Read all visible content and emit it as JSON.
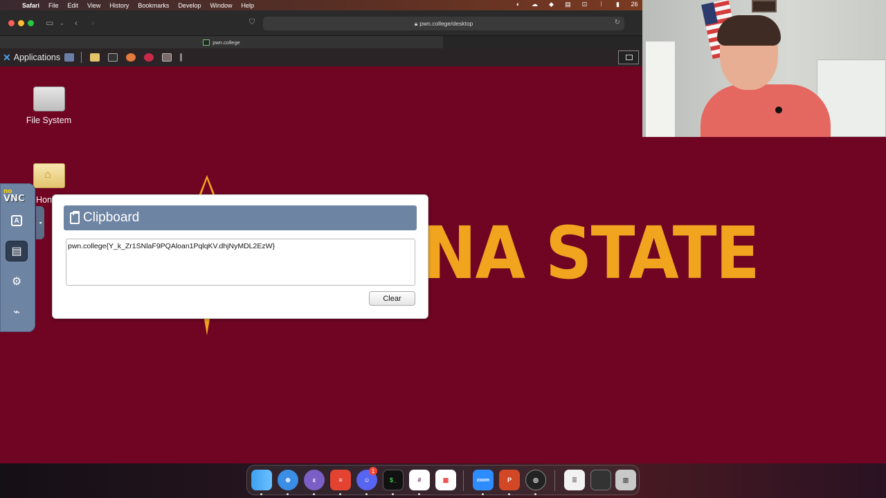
{
  "menubar": {
    "apple": "",
    "items": [
      "Safari",
      "File",
      "Edit",
      "View",
      "History",
      "Bookmarks",
      "Develop",
      "Window",
      "Help"
    ],
    "status_date": "26"
  },
  "safari": {
    "url": "pwn.college/desktop",
    "tab_title": "pwn.college"
  },
  "xfce": {
    "applications_label": "Applications"
  },
  "desktop": {
    "filesystem_label": "File System",
    "home_label": "Hon",
    "background_text": "NA STATE"
  },
  "novnc": {
    "logo_no": "no",
    "logo_vnc": "VNC"
  },
  "clipboard": {
    "title": "Clipboard",
    "content": "pwn.college{Y_k_Zr1SNlaF9PQAloan1PqlqKV.dhjNyMDL2EzW}",
    "clear_label": "Clear"
  },
  "dock": {
    "apps": [
      "Finder",
      "Safari",
      "Emacs",
      "Todoist",
      "Discord",
      "Terminal",
      "Slack",
      "Calendar",
      "Zoom",
      "PowerPoint",
      "OBS",
      "Document",
      "Screen",
      "Trash"
    ],
    "discord_badge": "1",
    "zoom_label": "zoom"
  },
  "colors": {
    "asu_maroon": "#6f0523",
    "asu_gold": "#f1a51e",
    "novnc_blue": "#6e84a3"
  }
}
